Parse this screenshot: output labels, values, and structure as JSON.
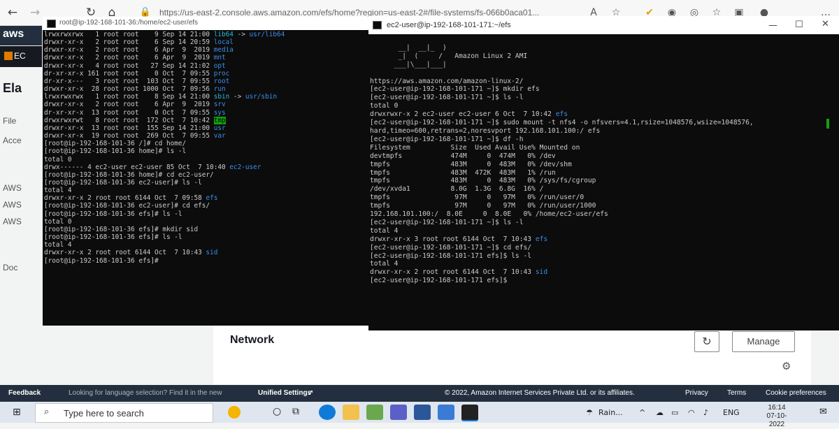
{
  "browser": {
    "url": "https://us-east-2.console.aws.amazon.com/efs/home?region=us-east-2#/file-systems/fs-066b0aca01..."
  },
  "aws": {
    "logo": "aws",
    "service_tag": "EC",
    "heading_partial": "Ela",
    "left_items": [
      "File",
      "Acce",
      "AWS",
      "AWS",
      "AWS",
      "Doc"
    ],
    "network_title": "Network",
    "refresh_icon": "refresh-icon",
    "manage_label": "Manage",
    "settings_icon": "gear-icon"
  },
  "footer": {
    "feedback": "Feedback",
    "language_prefix": "Looking for language selection? Find it in the new",
    "unified_settings": "Unified Settings",
    "copyright": "© 2022, Amazon Internet Services Private Ltd. or its affiliates.",
    "privacy": "Privacy",
    "terms": "Terms",
    "cookie": "Cookie preferences"
  },
  "taskbar": {
    "search_placeholder": "Type here to search",
    "weather": "Rain...",
    "lang": "ENG",
    "time": "16:14",
    "date": "07-10-2022"
  },
  "terminal_left": {
    "title": "root@ip-192-168-101-36:/home/ec2-user/efs",
    "lines": [
      [
        {
          "t": "lrwxrwxrwx   1 root root    9 Sep 14 21:00 "
        },
        {
          "t": "lib64",
          "c": "cyan"
        },
        {
          "t": " -> "
        },
        {
          "t": "usr/lib64",
          "c": "blue"
        }
      ],
      [
        {
          "t": "drwxr-xr-x   2 root root    6 Sep 14 20:59 "
        },
        {
          "t": "local",
          "c": "blue"
        }
      ],
      [
        {
          "t": "drwxr-xr-x   2 root root    6 Apr  9  2019 "
        },
        {
          "t": "media",
          "c": "blue"
        }
      ],
      [
        {
          "t": "drwxr-xr-x   2 root root    6 Apr  9  2019 "
        },
        {
          "t": "mnt",
          "c": "blue"
        }
      ],
      [
        {
          "t": "drwxr-xr-x   4 root root   27 Sep 14 21:02 "
        },
        {
          "t": "opt",
          "c": "blue"
        }
      ],
      [
        {
          "t": "dr-xr-xr-x 161 root root    0 Oct  7 09:55 "
        },
        {
          "t": "proc",
          "c": "blue"
        }
      ],
      [
        {
          "t": "dr-xr-x---   3 root root  103 Oct  7 09:55 "
        },
        {
          "t": "root",
          "c": "blue"
        }
      ],
      [
        {
          "t": "drwxr-xr-x  28 root root 1000 Oct  7 09:56 "
        },
        {
          "t": "run",
          "c": "blue"
        }
      ],
      [
        {
          "t": "lrwxrwxrwx   1 root root    8 Sep 14 21:00 "
        },
        {
          "t": "sbin",
          "c": "cyan"
        },
        {
          "t": " -> "
        },
        {
          "t": "usr/sbin",
          "c": "blue"
        }
      ],
      [
        {
          "t": "drwxr-xr-x   2 root root    6 Apr  9  2019 "
        },
        {
          "t": "srv",
          "c": "blue"
        }
      ],
      [
        {
          "t": "dr-xr-xr-x  13 root root    0 Oct  7 09:55 "
        },
        {
          "t": "sys",
          "c": "blue"
        }
      ],
      [
        {
          "t": "drwxrwxrwt   8 root root  172 Oct  7 10:42 "
        },
        {
          "t": "tmp",
          "c": "hl"
        }
      ],
      [
        {
          "t": "drwxr-xr-x  13 root root  155 Sep 14 21:00 "
        },
        {
          "t": "usr",
          "c": "blue"
        }
      ],
      [
        {
          "t": "drwxr-xr-x  19 root root  269 Oct  7 09:55 "
        },
        {
          "t": "var",
          "c": "blue"
        }
      ],
      [
        {
          "t": "[root@ip-192-168-101-36 /]# cd home/"
        }
      ],
      [
        {
          "t": "[root@ip-192-168-101-36 home]# ls -l"
        }
      ],
      [
        {
          "t": "total 0"
        }
      ],
      [
        {
          "t": "drwx------ 4 ec2-user ec2-user 85 Oct  7 10:40 "
        },
        {
          "t": "ec2-user",
          "c": "blue"
        }
      ],
      [
        {
          "t": "[root@ip-192-168-101-36 home]# cd ec2-user/"
        }
      ],
      [
        {
          "t": "[root@ip-192-168-101-36 ec2-user]# ls -l"
        }
      ],
      [
        {
          "t": "total 4"
        }
      ],
      [
        {
          "t": "drwxr-xr-x 2 root root 6144 Oct  7 09:58 "
        },
        {
          "t": "efs",
          "c": "blue"
        }
      ],
      [
        {
          "t": "[root@ip-192-168-101-36 ec2-user]# cd efs/"
        }
      ],
      [
        {
          "t": "[root@ip-192-168-101-36 efs]# ls -l"
        }
      ],
      [
        {
          "t": "total 0"
        }
      ],
      [
        {
          "t": "[root@ip-192-168-101-36 efs]# mkdir sid"
        }
      ],
      [
        {
          "t": "[root@ip-192-168-101-36 efs]# ls -l"
        }
      ],
      [
        {
          "t": "total 4"
        }
      ],
      [
        {
          "t": "drwxr-xr-x 2 root root 6144 Oct  7 10:43 "
        },
        {
          "t": "sid",
          "c": "blue"
        }
      ],
      [
        {
          "t": "[root@ip-192-168-101-36 efs]#"
        }
      ]
    ]
  },
  "terminal_right": {
    "title": "ec2-user@ip-192-168-101-171:~/efs",
    "lines": [
      [
        {
          "t": ""
        }
      ],
      [
        {
          "t": "       __|  __|_  )"
        }
      ],
      [
        {
          "t": "       _|  (     /   Amazon Linux 2 AMI"
        }
      ],
      [
        {
          "t": "      ___|\\___|___|"
        }
      ],
      [
        {
          "t": ""
        }
      ],
      [
        {
          "t": "https://aws.amazon.com/amazon-linux-2/"
        }
      ],
      [
        {
          "t": "[ec2-user@ip-192-168-101-171 ~]$ mkdir efs"
        }
      ],
      [
        {
          "t": "[ec2-user@ip-192-168-101-171 ~]$ ls -l"
        }
      ],
      [
        {
          "t": "total 0"
        }
      ],
      [
        {
          "t": "drwxrwxr-x 2 ec2-user ec2-user 6 Oct  7 10:42 "
        },
        {
          "t": "efs",
          "c": "blue"
        }
      ],
      [
        {
          "t": "[ec2-user@ip-192-168-101-171 ~]$ sudo mount -t nfs4 -o nfsvers=4.1,rsize=1048576,wsize=1048576,"
        }
      ],
      [
        {
          "t": "hard,timeo=600,retrans=2,noresvport 192.168.101.100:/ efs"
        }
      ],
      [
        {
          "t": "[ec2-user@ip-192-168-101-171 ~]$ df -h"
        }
      ],
      [
        {
          "t": "Filesystem          Size  Used Avail Use% Mounted on"
        }
      ],
      [
        {
          "t": "devtmpfs            474M     0  474M   0% /dev"
        }
      ],
      [
        {
          "t": "tmpfs               483M     0  483M   0% /dev/shm"
        }
      ],
      [
        {
          "t": "tmpfs               483M  472K  483M   1% /run"
        }
      ],
      [
        {
          "t": "tmpfs               483M     0  483M   0% /sys/fs/cgroup"
        }
      ],
      [
        {
          "t": "/dev/xvda1          8.0G  1.3G  6.8G  16% /"
        }
      ],
      [
        {
          "t": "tmpfs                97M     0   97M   0% /run/user/0"
        }
      ],
      [
        {
          "t": "tmpfs                97M     0   97M   0% /run/user/1000"
        }
      ],
      [
        {
          "t": "192.168.101.100:/  8.0E     0  8.0E   0% /home/ec2-user/efs"
        }
      ],
      [
        {
          "t": "[ec2-user@ip-192-168-101-171 ~]$ ls -l"
        }
      ],
      [
        {
          "t": "total 4"
        }
      ],
      [
        {
          "t": "drwxr-xr-x 3 root root 6144 Oct  7 10:43 "
        },
        {
          "t": "efs",
          "c": "blue"
        }
      ],
      [
        {
          "t": "[ec2-user@ip-192-168-101-171 ~]$ cd efs/"
        }
      ],
      [
        {
          "t": "[ec2-user@ip-192-168-101-171 efs]$ ls -l"
        }
      ],
      [
        {
          "t": "total 4"
        }
      ],
      [
        {
          "t": "drwxr-xr-x 2 root root 6144 Oct  7 10:43 "
        },
        {
          "t": "sid",
          "c": "blue"
        }
      ],
      [
        {
          "t": "[ec2-user@ip-192-168-101-171 efs]$"
        }
      ]
    ]
  }
}
